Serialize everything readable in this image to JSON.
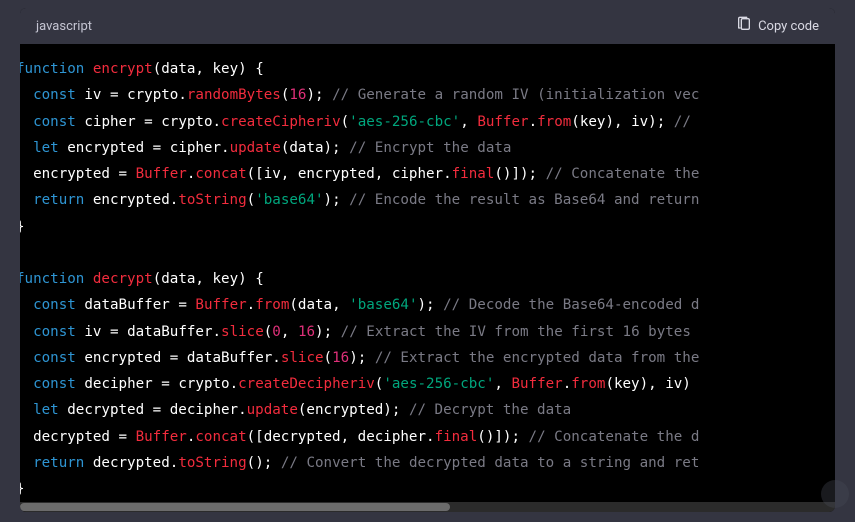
{
  "header": {
    "language": "javascript",
    "copy_label": "Copy code"
  },
  "code": {
    "lines": [
      [
        {
          "t": "kw",
          "v": "function"
        },
        {
          "t": "sp",
          "v": " "
        },
        {
          "t": "fn",
          "v": "encrypt"
        },
        {
          "t": "pl",
          "v": "("
        },
        {
          "t": "pl",
          "v": "data, key"
        },
        {
          "t": "pl",
          "v": ") {"
        }
      ],
      [
        {
          "t": "in",
          "v": "  "
        },
        {
          "t": "kw",
          "v": "const"
        },
        {
          "t": "sp",
          "v": " "
        },
        {
          "t": "pl",
          "v": "iv = crypto."
        },
        {
          "t": "fn",
          "v": "randomBytes"
        },
        {
          "t": "pl",
          "v": "("
        },
        {
          "t": "num",
          "v": "16"
        },
        {
          "t": "pl",
          "v": "); "
        },
        {
          "t": "cmt",
          "v": "// Generate a random IV (initialization vec"
        }
      ],
      [
        {
          "t": "in",
          "v": "  "
        },
        {
          "t": "kw",
          "v": "const"
        },
        {
          "t": "sp",
          "v": " "
        },
        {
          "t": "pl",
          "v": "cipher = crypto."
        },
        {
          "t": "fn",
          "v": "createCipheriv"
        },
        {
          "t": "pl",
          "v": "("
        },
        {
          "t": "str",
          "v": "'aes-256-cbc'"
        },
        {
          "t": "pl",
          "v": ", "
        },
        {
          "t": "fn",
          "v": "Buffer"
        },
        {
          "t": "pl",
          "v": "."
        },
        {
          "t": "fn",
          "v": "from"
        },
        {
          "t": "pl",
          "v": "(key), iv); "
        },
        {
          "t": "cmt",
          "v": "//"
        }
      ],
      [
        {
          "t": "in",
          "v": "  "
        },
        {
          "t": "kw",
          "v": "let"
        },
        {
          "t": "sp",
          "v": " "
        },
        {
          "t": "pl",
          "v": "encrypted = cipher."
        },
        {
          "t": "fn",
          "v": "update"
        },
        {
          "t": "pl",
          "v": "(data); "
        },
        {
          "t": "cmt",
          "v": "// Encrypt the data"
        }
      ],
      [
        {
          "t": "in",
          "v": "  "
        },
        {
          "t": "pl",
          "v": "encrypted = "
        },
        {
          "t": "fn",
          "v": "Buffer"
        },
        {
          "t": "pl",
          "v": "."
        },
        {
          "t": "fn",
          "v": "concat"
        },
        {
          "t": "pl",
          "v": "([iv, encrypted, cipher."
        },
        {
          "t": "fn",
          "v": "final"
        },
        {
          "t": "pl",
          "v": "()]); "
        },
        {
          "t": "cmt",
          "v": "// Concatenate the"
        }
      ],
      [
        {
          "t": "in",
          "v": "  "
        },
        {
          "t": "kw",
          "v": "return"
        },
        {
          "t": "sp",
          "v": " "
        },
        {
          "t": "pl",
          "v": "encrypted."
        },
        {
          "t": "fn",
          "v": "toString"
        },
        {
          "t": "pl",
          "v": "("
        },
        {
          "t": "str",
          "v": "'base64'"
        },
        {
          "t": "pl",
          "v": "); "
        },
        {
          "t": "cmt",
          "v": "// Encode the result as Base64 and return"
        }
      ],
      [
        {
          "t": "pl",
          "v": "}"
        }
      ],
      [
        {
          "t": "pl",
          "v": ""
        }
      ],
      [
        {
          "t": "kw",
          "v": "function"
        },
        {
          "t": "sp",
          "v": " "
        },
        {
          "t": "fn",
          "v": "decrypt"
        },
        {
          "t": "pl",
          "v": "("
        },
        {
          "t": "pl",
          "v": "data, key"
        },
        {
          "t": "pl",
          "v": ") {"
        }
      ],
      [
        {
          "t": "in",
          "v": "  "
        },
        {
          "t": "kw",
          "v": "const"
        },
        {
          "t": "sp",
          "v": " "
        },
        {
          "t": "pl",
          "v": "dataBuffer = "
        },
        {
          "t": "fn",
          "v": "Buffer"
        },
        {
          "t": "pl",
          "v": "."
        },
        {
          "t": "fn",
          "v": "from"
        },
        {
          "t": "pl",
          "v": "(data, "
        },
        {
          "t": "str",
          "v": "'base64'"
        },
        {
          "t": "pl",
          "v": "); "
        },
        {
          "t": "cmt",
          "v": "// Decode the Base64-encoded d"
        }
      ],
      [
        {
          "t": "in",
          "v": "  "
        },
        {
          "t": "kw",
          "v": "const"
        },
        {
          "t": "sp",
          "v": " "
        },
        {
          "t": "pl",
          "v": "iv = dataBuffer."
        },
        {
          "t": "fn",
          "v": "slice"
        },
        {
          "t": "pl",
          "v": "("
        },
        {
          "t": "num",
          "v": "0"
        },
        {
          "t": "pl",
          "v": ", "
        },
        {
          "t": "num",
          "v": "16"
        },
        {
          "t": "pl",
          "v": "); "
        },
        {
          "t": "cmt",
          "v": "// Extract the IV from the first 16 bytes"
        }
      ],
      [
        {
          "t": "in",
          "v": "  "
        },
        {
          "t": "kw",
          "v": "const"
        },
        {
          "t": "sp",
          "v": " "
        },
        {
          "t": "pl",
          "v": "encrypted = dataBuffer."
        },
        {
          "t": "fn",
          "v": "slice"
        },
        {
          "t": "pl",
          "v": "("
        },
        {
          "t": "num",
          "v": "16"
        },
        {
          "t": "pl",
          "v": "); "
        },
        {
          "t": "cmt",
          "v": "// Extract the encrypted data from the"
        }
      ],
      [
        {
          "t": "in",
          "v": "  "
        },
        {
          "t": "kw",
          "v": "const"
        },
        {
          "t": "sp",
          "v": " "
        },
        {
          "t": "pl",
          "v": "decipher = crypto."
        },
        {
          "t": "fn",
          "v": "createDecipheriv"
        },
        {
          "t": "pl",
          "v": "("
        },
        {
          "t": "str",
          "v": "'aes-256-cbc'"
        },
        {
          "t": "pl",
          "v": ", "
        },
        {
          "t": "fn",
          "v": "Buffer"
        },
        {
          "t": "pl",
          "v": "."
        },
        {
          "t": "fn",
          "v": "from"
        },
        {
          "t": "pl",
          "v": "(key), iv)"
        }
      ],
      [
        {
          "t": "in",
          "v": "  "
        },
        {
          "t": "kw",
          "v": "let"
        },
        {
          "t": "sp",
          "v": " "
        },
        {
          "t": "pl",
          "v": "decrypted = decipher."
        },
        {
          "t": "fn",
          "v": "update"
        },
        {
          "t": "pl",
          "v": "(encrypted); "
        },
        {
          "t": "cmt",
          "v": "// Decrypt the data"
        }
      ],
      [
        {
          "t": "in",
          "v": "  "
        },
        {
          "t": "pl",
          "v": "decrypted = "
        },
        {
          "t": "fn",
          "v": "Buffer"
        },
        {
          "t": "pl",
          "v": "."
        },
        {
          "t": "fn",
          "v": "concat"
        },
        {
          "t": "pl",
          "v": "([decrypted, decipher."
        },
        {
          "t": "fn",
          "v": "final"
        },
        {
          "t": "pl",
          "v": "()]); "
        },
        {
          "t": "cmt",
          "v": "// Concatenate the d"
        }
      ],
      [
        {
          "t": "in",
          "v": "  "
        },
        {
          "t": "kw",
          "v": "return"
        },
        {
          "t": "sp",
          "v": " "
        },
        {
          "t": "pl",
          "v": "decrypted."
        },
        {
          "t": "fn",
          "v": "toString"
        },
        {
          "t": "pl",
          "v": "(); "
        },
        {
          "t": "cmt",
          "v": "// Convert the decrypted data to a string and ret"
        }
      ],
      [
        {
          "t": "pl",
          "v": "}"
        }
      ]
    ]
  }
}
